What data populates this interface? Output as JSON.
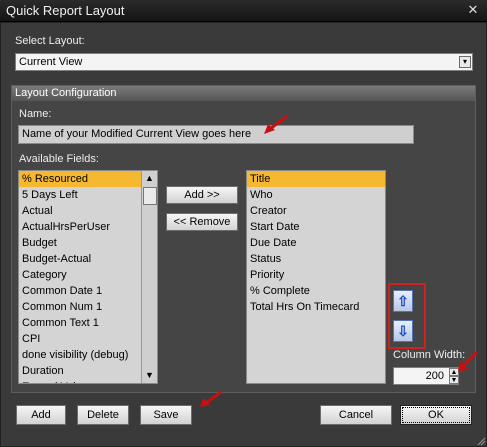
{
  "window": {
    "title": "Quick Report Layout",
    "close_glyph": "✕"
  },
  "select_layout": {
    "label": "Select Layout:",
    "value": "Current View",
    "dropdown_glyph": "▾"
  },
  "layout_config": {
    "header": "Layout Configuration",
    "name_label": "Name:",
    "name_value": "Name of your Modified Current View goes here",
    "available_label": "Available Fields:",
    "available_fields": [
      "% Resourced",
      "5 Days Left",
      "Actual",
      "ActualHrsPerUser",
      "Budget",
      "Budget-Actual",
      "Category",
      "Common Date 1",
      "Common Num 1",
      "Common Text 1",
      "CPI",
      "done visibility (debug)",
      "Duration",
      "Earned Value"
    ],
    "available_selected_index": 0,
    "selected_fields": [
      "Title",
      "Who",
      "Creator",
      "Start Date",
      "Due Date",
      "Status",
      "Priority",
      "% Complete",
      "Total Hrs On Timecard"
    ],
    "selected_selected_index": 0,
    "add_label": "Add >>",
    "remove_label": "<< Remove",
    "move_up_icon": "up-arrow-icon",
    "move_down_icon": "down-arrow-icon",
    "column_width_label": "Column Width:",
    "column_width_value": "200"
  },
  "footer": {
    "add_label": "Add",
    "delete_label": "Delete",
    "save_label": "Save",
    "cancel_label": "Cancel",
    "ok_label": "OK"
  },
  "colors": {
    "selection": "#f5b830",
    "annotation_arrow": "#c81010",
    "annotation_box": "#d02020"
  }
}
